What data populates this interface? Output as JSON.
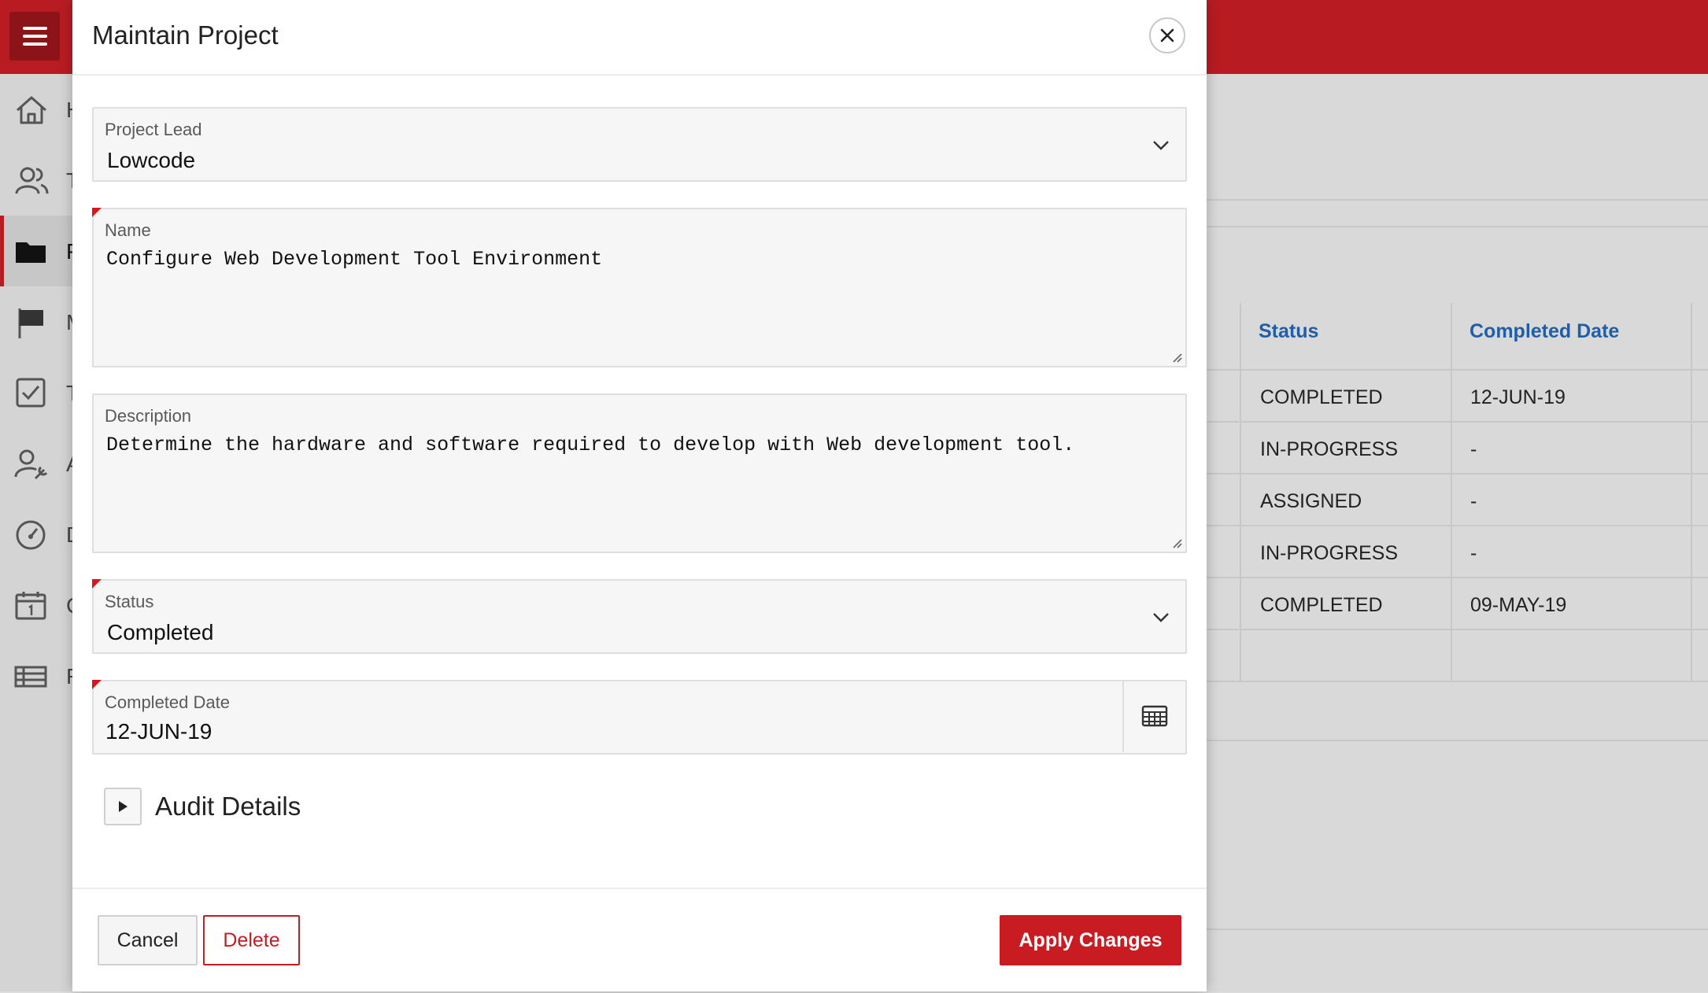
{
  "dialog": {
    "title": "Maintain Project",
    "fields": {
      "project_lead": {
        "label": "Project Lead",
        "value": "Lowcode"
      },
      "name": {
        "label": "Name",
        "value": "Configure Web Development Tool Environment"
      },
      "description": {
        "label": "Description",
        "value": "Determine the hardware and software required to develop with Web development tool."
      },
      "status": {
        "label": "Status",
        "value": "Completed"
      },
      "completed_date": {
        "label": "Completed Date",
        "value": "12-JUN-19"
      }
    },
    "audit_details_label": "Audit Details",
    "buttons": {
      "cancel": "Cancel",
      "delete": "Delete",
      "apply": "Apply Changes"
    }
  },
  "background_table": {
    "headers": {
      "status": "Status",
      "completed_date": "Completed Date"
    },
    "rows": [
      {
        "status": "COMPLETED",
        "completed_date": "12-JUN-19"
      },
      {
        "status": "IN-PROGRESS",
        "completed_date": "-"
      },
      {
        "status": "ASSIGNED",
        "completed_date": "-"
      },
      {
        "status": "IN-PROGRESS",
        "completed_date": "-"
      },
      {
        "status": "COMPLETED",
        "completed_date": "09-MAY-19"
      }
    ]
  },
  "colors": {
    "brand_red": "#b81c22",
    "link_blue": "#1f5ea8",
    "required_marker": "#e0131d"
  },
  "icons": [
    "menu-icon",
    "home-icon",
    "team-icon",
    "folder-icon",
    "flag-icon",
    "checkbox-icon",
    "admin-icon",
    "dashboard-icon",
    "calendar-icon",
    "report-icon",
    "close-icon",
    "chevron-down-icon",
    "calendar-picker-icon",
    "expand-triangle-icon"
  ]
}
